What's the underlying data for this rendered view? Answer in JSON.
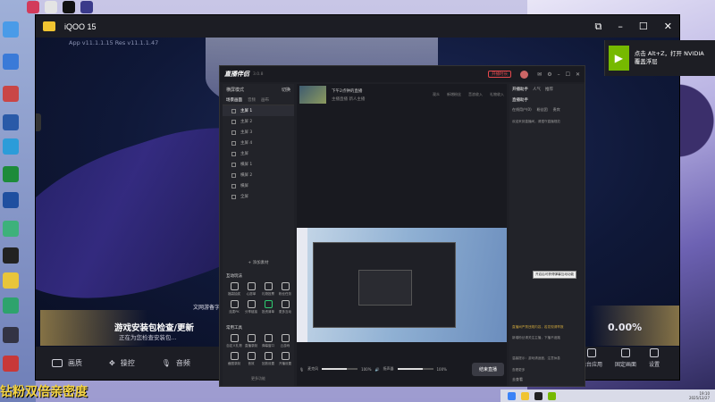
{
  "emulator": {
    "title": "iQOO 15",
    "version": "App v11.1.1.15 Res v11.1.1.47",
    "author_text": "文网游备字",
    "update_title": "游戏安装包检查/更新",
    "update_sub": "正在为您检查安装包...",
    "percent": "0.00%",
    "bottom_left": [
      "画质",
      "操控",
      "音频"
    ],
    "bottom_right": [
      "后台应用",
      "固定画面",
      "设置"
    ]
  },
  "nvidia_toast": {
    "logo": "▶",
    "text": "点击 Alt+Z，打开 NVIDIA 覆盖浮层"
  },
  "live_app": {
    "brand": "直播伴侣",
    "version": "3.0.8",
    "record_label": "开播时长",
    "mode_label": "横屏模式",
    "mode_toggle": "切换",
    "left_tabs": [
      "场景画面",
      "音频",
      "画布"
    ],
    "scenes": [
      "主屏 1",
      "主屏 2",
      "主屏 3",
      "主屏 4",
      "主屏",
      "横屏 1",
      "横屏 2",
      "横屏",
      "全屏"
    ],
    "add_source": "+ 添加素材",
    "tools_heading": "互动玩法",
    "tools_row1": [
      "福袋抽奖",
      "心愿单",
      "礼物投票",
      "粉丝任务"
    ],
    "tools_row2": [
      "连麦PK",
      "分享链接",
      "投资清单",
      "更多互动"
    ],
    "tools_heading2": "常用工具",
    "tools_row3": [
      "自定义礼物",
      "直播录制",
      "弹幕窗口",
      "云游戏"
    ],
    "tools_row4": [
      "截图录制",
      "音效",
      "回放设置",
      "开播设置"
    ],
    "more_fn": "更多功能",
    "stream_title": "下午2点钟的直播",
    "tags": [
      "主播直播",
      "新人主播"
    ],
    "stats": [
      "观众",
      "新增粉丝",
      "音浪收入",
      "礼物收入"
    ],
    "mixer": [
      "麦克风",
      "100%",
      "扬声器",
      "100%"
    ],
    "go_live": "结束直播",
    "right_tabs": [
      "开播助手",
      "人气",
      "推荐"
    ],
    "right_heading": "直播助手",
    "right_sub": [
      "在线用户(0)",
      "粉丝团",
      "贵宾"
    ],
    "chat": [
      "欢迎来到直播间，请遵守直播规范",
      "直播间严禁违规内容，若发现请举报",
      "新增粉丝请关注主播，下播不迷路",
      "温馨提示：游戏请适度，注意休息",
      "查看更多"
    ],
    "chat_btn": "去查看"
  },
  "tooltip": "开启后可获得弹幕互动功能",
  "caption": "钻粉双倍亲密度",
  "taskbar": {
    "time": "19:10",
    "date": "2025/12/27"
  }
}
